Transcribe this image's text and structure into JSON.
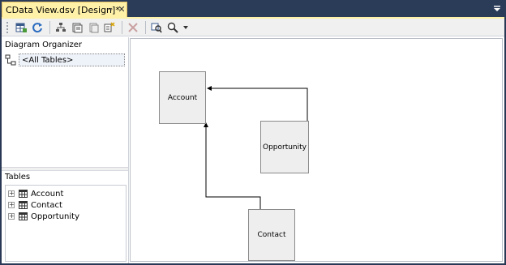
{
  "tab": {
    "title": "CData View.dsv [Design]*",
    "pin_glyph": "⊸",
    "close_glyph": "✕"
  },
  "toolbar": {
    "buttons": [
      {
        "icon": "add-remove-tables-icon"
      },
      {
        "icon": "refresh-icon"
      },
      {
        "icon": "arrange-tables-icon"
      },
      {
        "icon": "new-named-query-icon"
      },
      {
        "icon": "new-relationship-icon"
      },
      {
        "icon": "new-named-calculation-icon"
      },
      {
        "icon": "delete-icon"
      },
      {
        "icon": "find-table-icon"
      },
      {
        "icon": "zoom-icon"
      },
      {
        "icon": "chevron-down-icon"
      }
    ]
  },
  "diagram_organizer": {
    "title": "Diagram Organizer",
    "selected_diagram": "<All Tables>"
  },
  "tables_pane": {
    "title": "Tables",
    "items": [
      {
        "label": "Account"
      },
      {
        "label": "Contact"
      },
      {
        "label": "Opportunity"
      }
    ]
  },
  "diagram": {
    "entities": [
      {
        "name": "Account"
      },
      {
        "name": "Opportunity"
      },
      {
        "name": "Contact"
      }
    ]
  }
}
